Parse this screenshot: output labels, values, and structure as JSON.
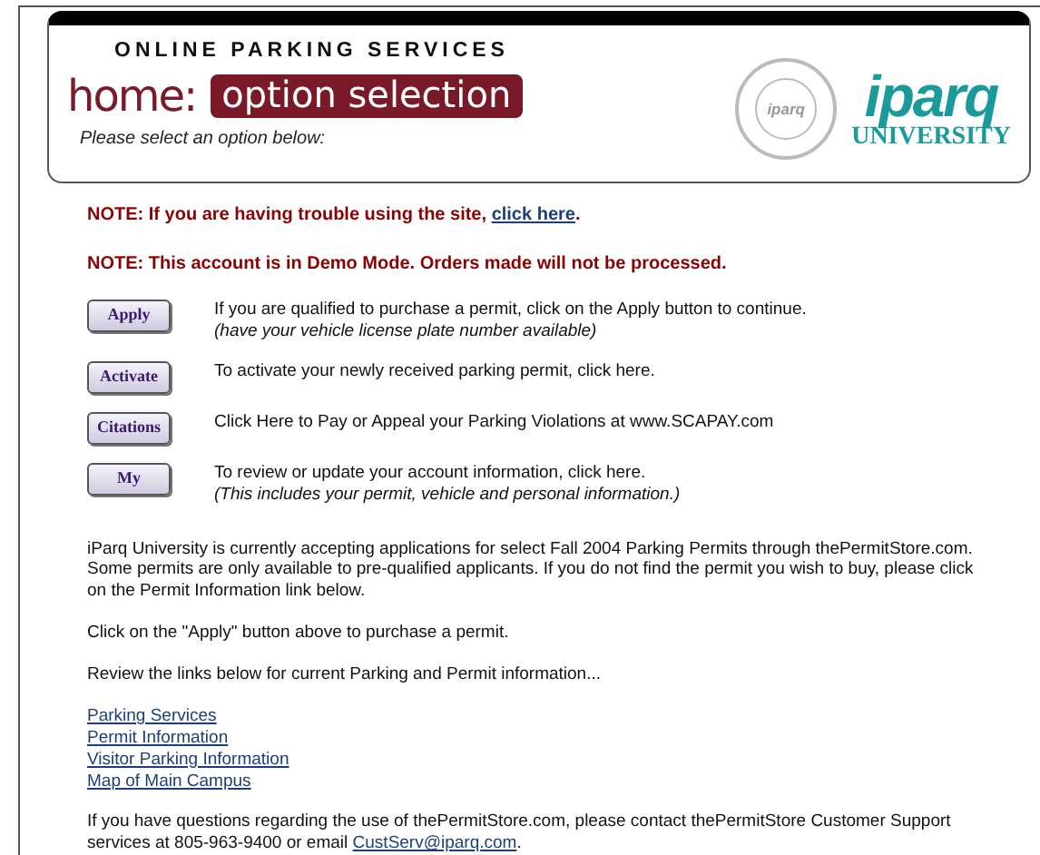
{
  "header": {
    "service": "ONLINE PARKING SERVICES",
    "home": "home:",
    "section": "option selection",
    "prompt": "Please select an option below:",
    "seal_text": "iparq",
    "logo_name": "iparq",
    "logo_sub": "UNIVERSITY"
  },
  "notes": [
    {
      "before": "NOTE: If you are having trouble using the site, ",
      "link": "click here",
      "after": "."
    },
    {
      "before": "NOTE: This account is in Demo Mode. Orders made will not be processed."
    }
  ],
  "options": [
    {
      "button": "Apply",
      "lines": [
        "If you are qualified to purchase a permit, click on the Apply button to continue.",
        "(have your vehicle license plate number available)"
      ]
    },
    {
      "button": "Activate",
      "lines": [
        "To activate your newly received parking permit, click here."
      ]
    },
    {
      "button": "Citations",
      "lines": [
        "Click Here to Pay or Appeal your Parking Violations at www.SCAPAY.com"
      ]
    },
    {
      "button": "My",
      "lines": [
        "To review or update your account information, click here.",
        "(This includes your permit, vehicle and personal information.)"
      ]
    }
  ],
  "paragraphs": [
    "iParq University is currently accepting applications for select Fall 2004 Parking Permits through thePermitStore.com. Some permits are only available to pre-qualified applicants. If you do not find the permit you wish to buy, please click on the Permit Information link below.",
    "Click on the \"Apply\" button above to purchase a permit.",
    "Review the links below for current Parking and Permit information..."
  ],
  "links": [
    "Parking Services",
    "Permit Information",
    "Visitor Parking Information",
    "Map of Main Campus"
  ],
  "contact": {
    "before": "If you have questions regarding the use of thePermitStore.com, please contact thePermitStore Customer Support services at 805-963-9400 or email ",
    "link": "CustServ@iparq.com",
    "after": "."
  }
}
